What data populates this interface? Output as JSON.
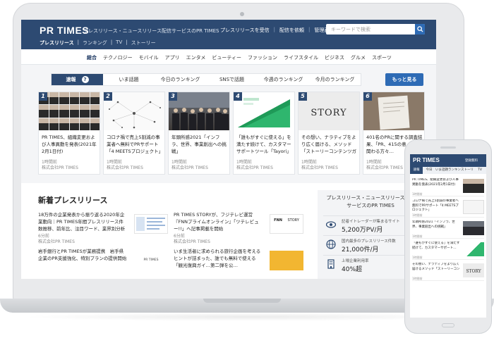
{
  "header": {
    "logo": "PR TIMES",
    "tagline": "プレスリリース・ニュースリリース配信サービスのPR TIMES",
    "links": [
      "プレスリリースを受信",
      "配信を依頼",
      "管理画面"
    ],
    "search_placeholder": "キーワードで検索"
  },
  "subnav": [
    "プレスリリース",
    "ランキング",
    "TV",
    "ストーリー"
  ],
  "categories": [
    "総合",
    "テクノロジー",
    "モバイル",
    "アプリ",
    "エンタメ",
    "ビューティー",
    "ファッション",
    "ライフスタイル",
    "ビジネス",
    "グルメ",
    "スポーツ"
  ],
  "ranking_tabs": [
    "速報",
    "いま話題",
    "今日のランキング",
    "SNSで話題",
    "今週のランキング",
    "今月のランキング"
  ],
  "more_button": "もっと見る",
  "ranking_cards": [
    {
      "rank": "1",
      "title": "PR TIMES、組織変更および人事異動を発表(2021年2月1日付)",
      "time": "1時間前",
      "company": "株式会社PR TIMES"
    },
    {
      "rank": "2",
      "title": "コロナ禍で売上5割減の事業者へ無料でPRサポート「4 MEETSプロジェクト」が対象とフローを…",
      "time": "1時間前",
      "company": "株式会社PR TIMES"
    },
    {
      "rank": "3",
      "title": "年頭所感2021「インフラ、世界、事業創出への挑戦」",
      "time": "1時間前",
      "company": "株式会社PR TIMES"
    },
    {
      "rank": "4",
      "title": "「誰もがすぐに使える」を満たす続けて、カスタマーサポートツール「Tayori」利用アカウント数4…",
      "time": "1時間前",
      "company": "株式会社PR TIMES"
    },
    {
      "rank": "5",
      "title": "その想い、ナラティブをより広く届ける、メソッド「ストーリーコンテンツガイド」を公開。「PR TIMES…",
      "time": "1時間前",
      "company": "株式会社PR TIMES"
    },
    {
      "rank": "6",
      "title": "401名のPRに関する調査結果、「PR、415の意…PRに関わる方々…",
      "time": "1時間前",
      "company": "株式会社PR TIMES"
    }
  ],
  "new_section": {
    "title": "新着プレスリリース",
    "items": [
      {
        "title": "18万件の企業発表から振り返る2020年企業動向｜PR TIMES年間プレスリリース件数推移、前年比、注目ワード、業界別分析を公開",
        "time": "6分前",
        "company": "株式会社PR TIMES"
      },
      {
        "title": "PR TIMES STORYが、フジテレビ運営『FNNプライムオンライン』「ツテレビュー!!」へ記事掲載を開始",
        "time": "6分前",
        "company": "株式会社PR TIMES"
      },
      {
        "title": "岩手銀行とPR TIMESが業務提携　岩手県企業のPR支援強化、特別プランの提供開始",
        "time": "",
        "company": ""
      },
      {
        "title": "いま生活者に求められる旅行企画を考えるヒントが詰まった、誰でも無料で使える「観光復興ガイ…第二弾を公…",
        "time": "",
        "company": ""
      }
    ],
    "img_labels": [
      "PR TIMES",
      "FNN",
      "STORY"
    ]
  },
  "sidebar": {
    "heading": "プレスリリース・ニュースリリース配信サービスのPR TIMES",
    "stats": [
      {
        "icon": "eye-icon",
        "label": "記者イトレーダーが集まるサイト",
        "value": "5,200万PV/月"
      },
      {
        "icon": "globe-icon",
        "label": "国内最多のプレスリリース件数",
        "value": "21,000件/月"
      },
      {
        "icon": "building-icon",
        "label": "上場企業利用率",
        "value": "40%超"
      }
    ]
  },
  "phone": {
    "logo": "PR TIMES",
    "register": "登録無料",
    "tabs": [
      "速報",
      "今日",
      "いま話題",
      "ランキング",
      "ストーリー",
      "TV"
    ],
    "items": [
      {
        "title": "PR TIMES、組織変更および人事異動を発表(2021年2月1日付)",
        "meta": "1時間前"
      },
      {
        "title": "コロナ禍で売上5割減の事業者へ無料でPRサポート「4 MEETSプロジェクト」",
        "meta": "1時間前"
      },
      {
        "title": "年頭所感2021「インフラ、世界、事業創出への挑戦」",
        "meta": "1時間前"
      },
      {
        "title": "「誰もがすぐに使える」を満たす続けて、カスタマーサポート…",
        "meta": "1時間前"
      },
      {
        "title": "その想い、ナラティブをより広く届けるメソッド「ストーリーコン",
        "meta": "1時間前"
      }
    ]
  },
  "colors": {
    "navy": "#2d4a72",
    "accent": "#2e6bb5",
    "bg": "#f4f5f7"
  }
}
